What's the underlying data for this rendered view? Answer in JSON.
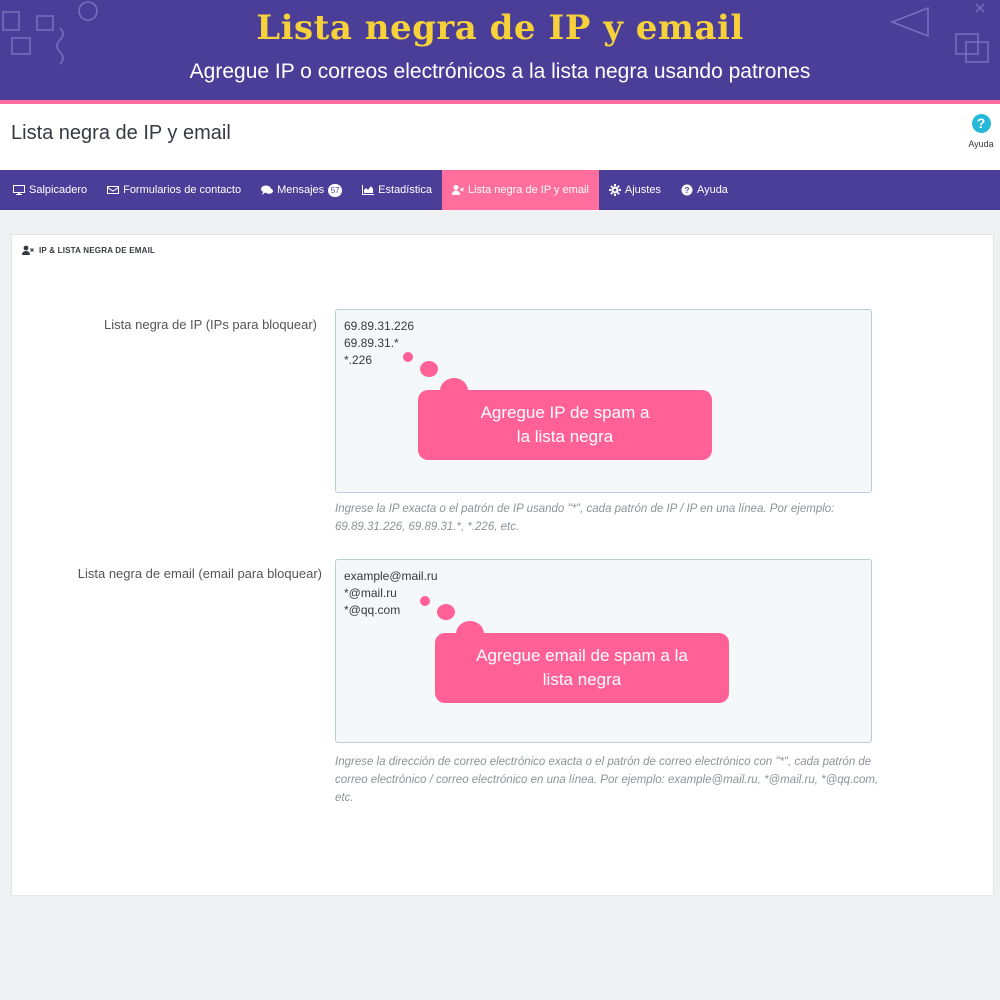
{
  "banner": {
    "title": "Lista negra de IP y email",
    "subtitle": "Agregue IP o correos electrónicos a la lista negra usando patrones"
  },
  "header": {
    "title": "Lista negra de IP y email",
    "help_label": "Ayuda",
    "help_icon": "question-circle-icon"
  },
  "tabs": [
    {
      "label": "Salpicadero",
      "icon": "monitor-icon"
    },
    {
      "label": "Formularios de contacto",
      "icon": "envelope-icon"
    },
    {
      "label": "Mensajes",
      "icon": "comments-icon",
      "badge": "57"
    },
    {
      "label": "Estadística",
      "icon": "area-chart-icon"
    },
    {
      "label": "Lista negra de IP y email",
      "icon": "user-times-icon",
      "active": true
    },
    {
      "label": "Ajustes",
      "icon": "gear-icon"
    },
    {
      "label": "Ayuda",
      "icon": "question-circle-icon"
    }
  ],
  "panel": {
    "heading": "IP & LISTA NEGRA DE EMAIL",
    "ip": {
      "label": "Lista negra de IP (IPs para bloquear)",
      "lines": [
        "69.89.31.226",
        "69.89.31.*",
        "*.226"
      ],
      "hint": "Ingrese la IP exacta o el patrón de IP usando \"*\", cada patrón de IP / IP en una línea. Por ejemplo: 69.89.31.226, 69.89.31.*, *.226, etc.",
      "callout_line1": "Agregue IP de spam a",
      "callout_line2": "la lista negra"
    },
    "email": {
      "label": "Lista negra de email (email para bloquear)",
      "lines": [
        "example@mail.ru",
        "*@mail.ru",
        "*@qq.com"
      ],
      "hint": "Ingrese la dirección de correo electrónico exacta o el patrón de correo electrónico con \"*\", cada patrón de correo electrónico / correo electrónico en una línea. Por ejemplo: example@mail.ru, *@mail.ru, *@qq.com, etc.",
      "callout_line1": "Agregue email de spam a la",
      "callout_line2": "lista negra"
    }
  },
  "colors": {
    "brand_purple": "#4b3e99",
    "accent_pink": "#ff6e9c",
    "title_yellow": "#f7d13a",
    "help_blue": "#25b9d7"
  }
}
